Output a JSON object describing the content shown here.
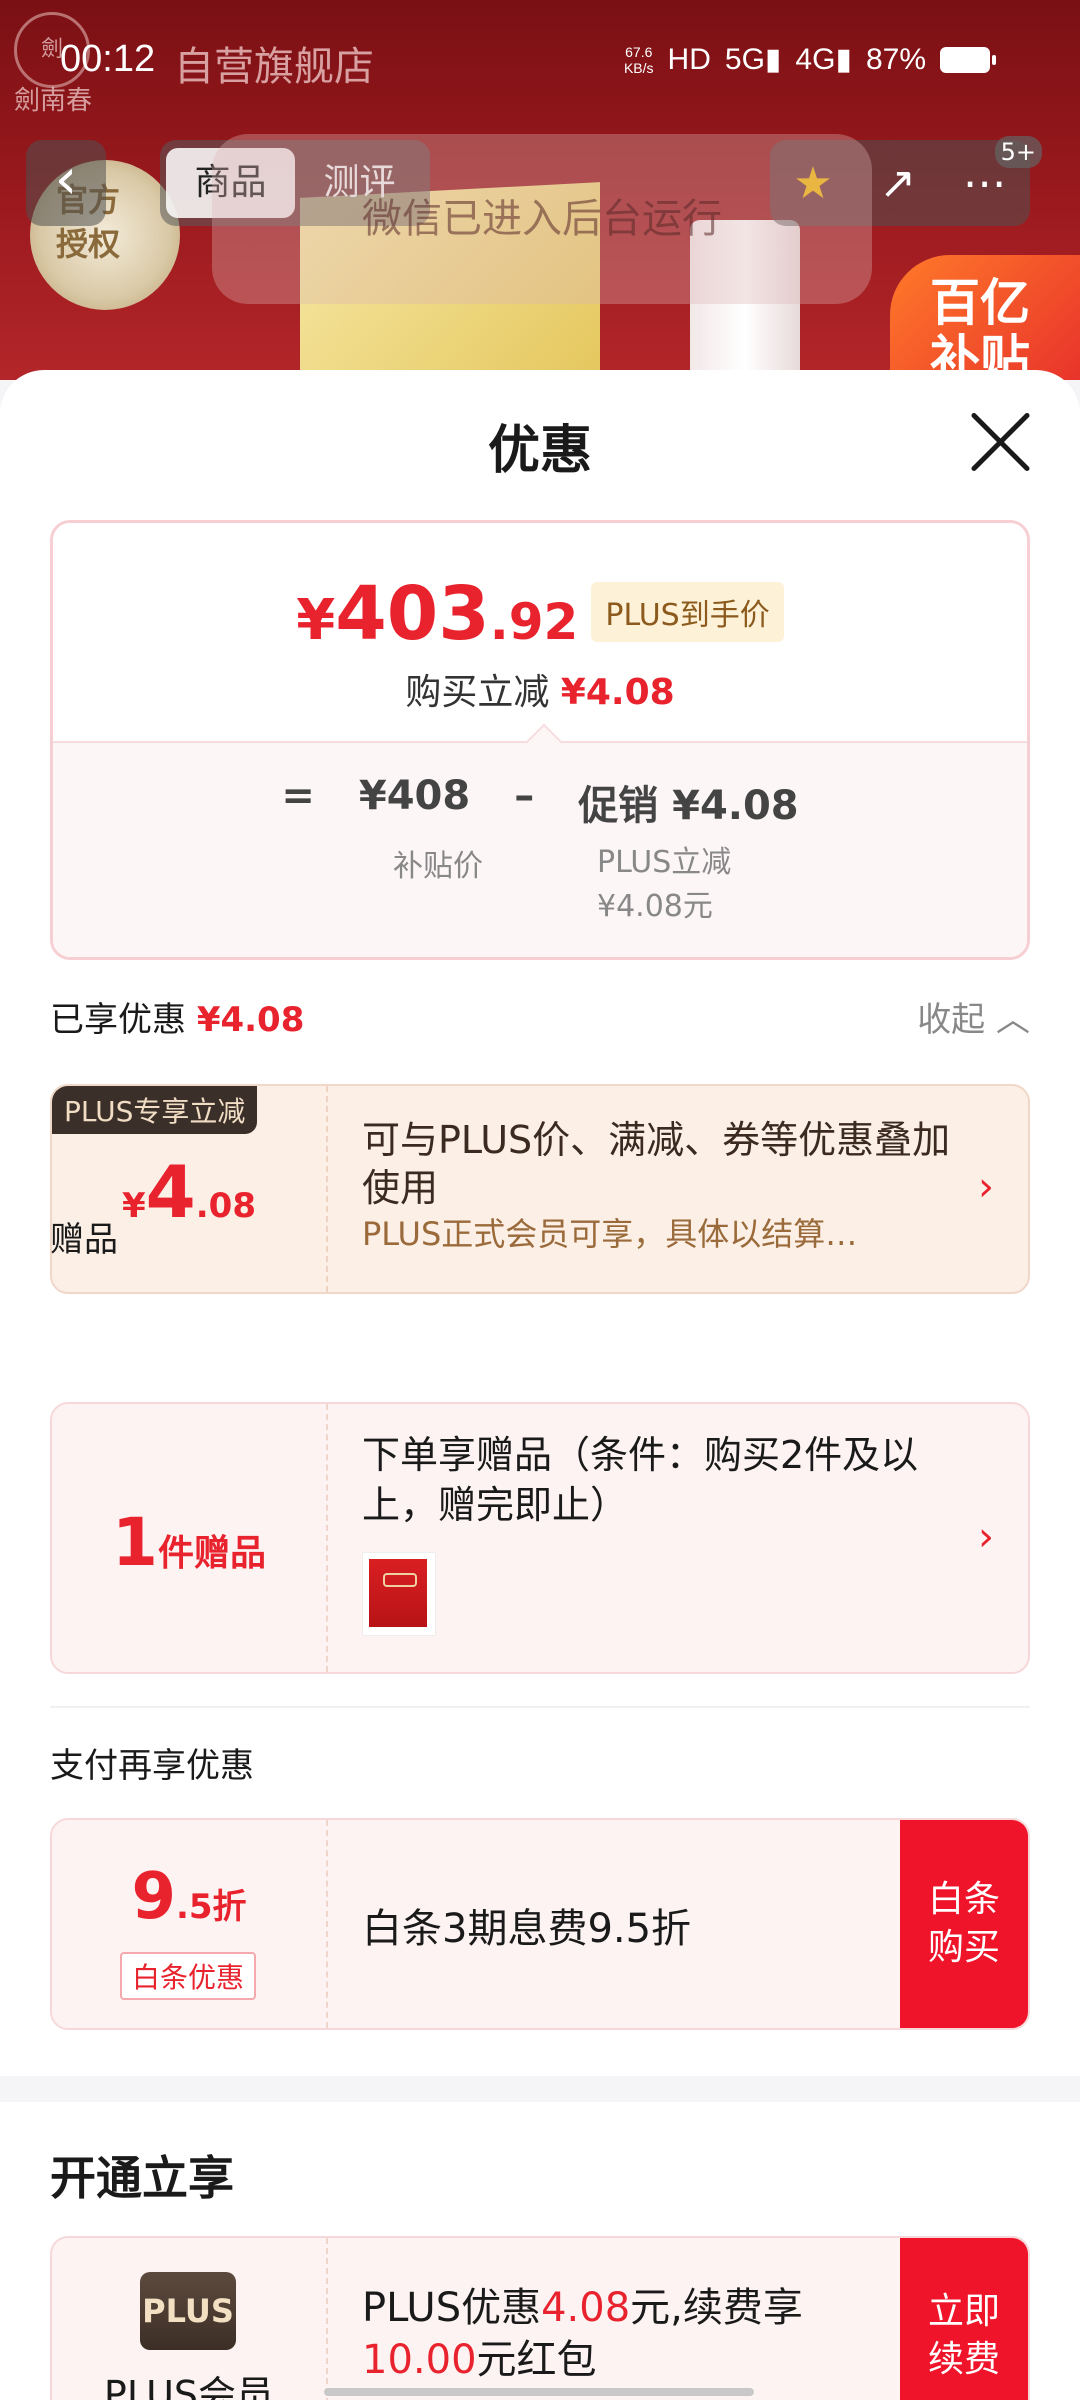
{
  "status_bar": {
    "time": "00:12",
    "net_speed": "67.6 KB/s",
    "battery": "87%",
    "icons": [
      "hd-icon",
      "5g-signal-icon",
      "4g-signal-icon",
      "battery-icon"
    ]
  },
  "background": {
    "store_name": "自营旗舰店",
    "brand_logo_text": "劍南春",
    "badge_text": "官方授权",
    "subsidy_text": "百亿补贴"
  },
  "nav": {
    "tabs": [
      "商品",
      "测评"
    ],
    "active_tab": 0,
    "notification_badge": "5+"
  },
  "toast": "微信已进入后台运行",
  "sheet": {
    "title": "优惠",
    "price_card": {
      "currency": "¥",
      "price_int": "403",
      "price_dec": ".92",
      "plus_tag": "PLUS到手价",
      "sub_prefix": "购买立减",
      "sub_amount": "¥4.08",
      "formula_eq": "=",
      "formula_base": "¥408",
      "formula_minus": "–",
      "formula_promo": "促销 ¥4.08",
      "base_label": "补贴价",
      "promo_label_1": "PLUS立减",
      "promo_label_2": "¥4.08元"
    },
    "enjoyed_label": "已享优惠",
    "enjoyed_amount": "¥4.08",
    "collapse_label": "收起",
    "plus_offer": {
      "badge": "PLUS专享立减",
      "yen": "¥",
      "int": "4",
      "dec": ".08",
      "title": "可与PLUS价、满减、券等优惠叠加使用",
      "subtitle": "PLUS正式会员可享，具体以结算…"
    },
    "gift_label": "赠品",
    "gift_offer": {
      "count": "1",
      "unit": "件赠品",
      "title": "下单享赠品（条件：购买2件及以上，赠完即止）"
    },
    "pay_label": "支付再享优惠",
    "pay_offer": {
      "int": "9",
      "dec": ".5折",
      "badge": "白条优惠",
      "title": "白条3期息费9.5折",
      "button_line1": "白条",
      "button_line2": "购买"
    },
    "open_title": "开通立享",
    "plus_member": {
      "logo": "PLUS",
      "name": "PLUS会员",
      "text_a": "PLUS优惠",
      "amount_a": "4.08",
      "text_b": "元,续费享",
      "amount_b": "10.00",
      "text_c": "元红包",
      "button_line1": "立即",
      "button_line2": "续费"
    }
  },
  "colors": {
    "accent_red": "#e8232e",
    "button_red": "#f0142a",
    "plus_gold": "#8b5a1c"
  }
}
